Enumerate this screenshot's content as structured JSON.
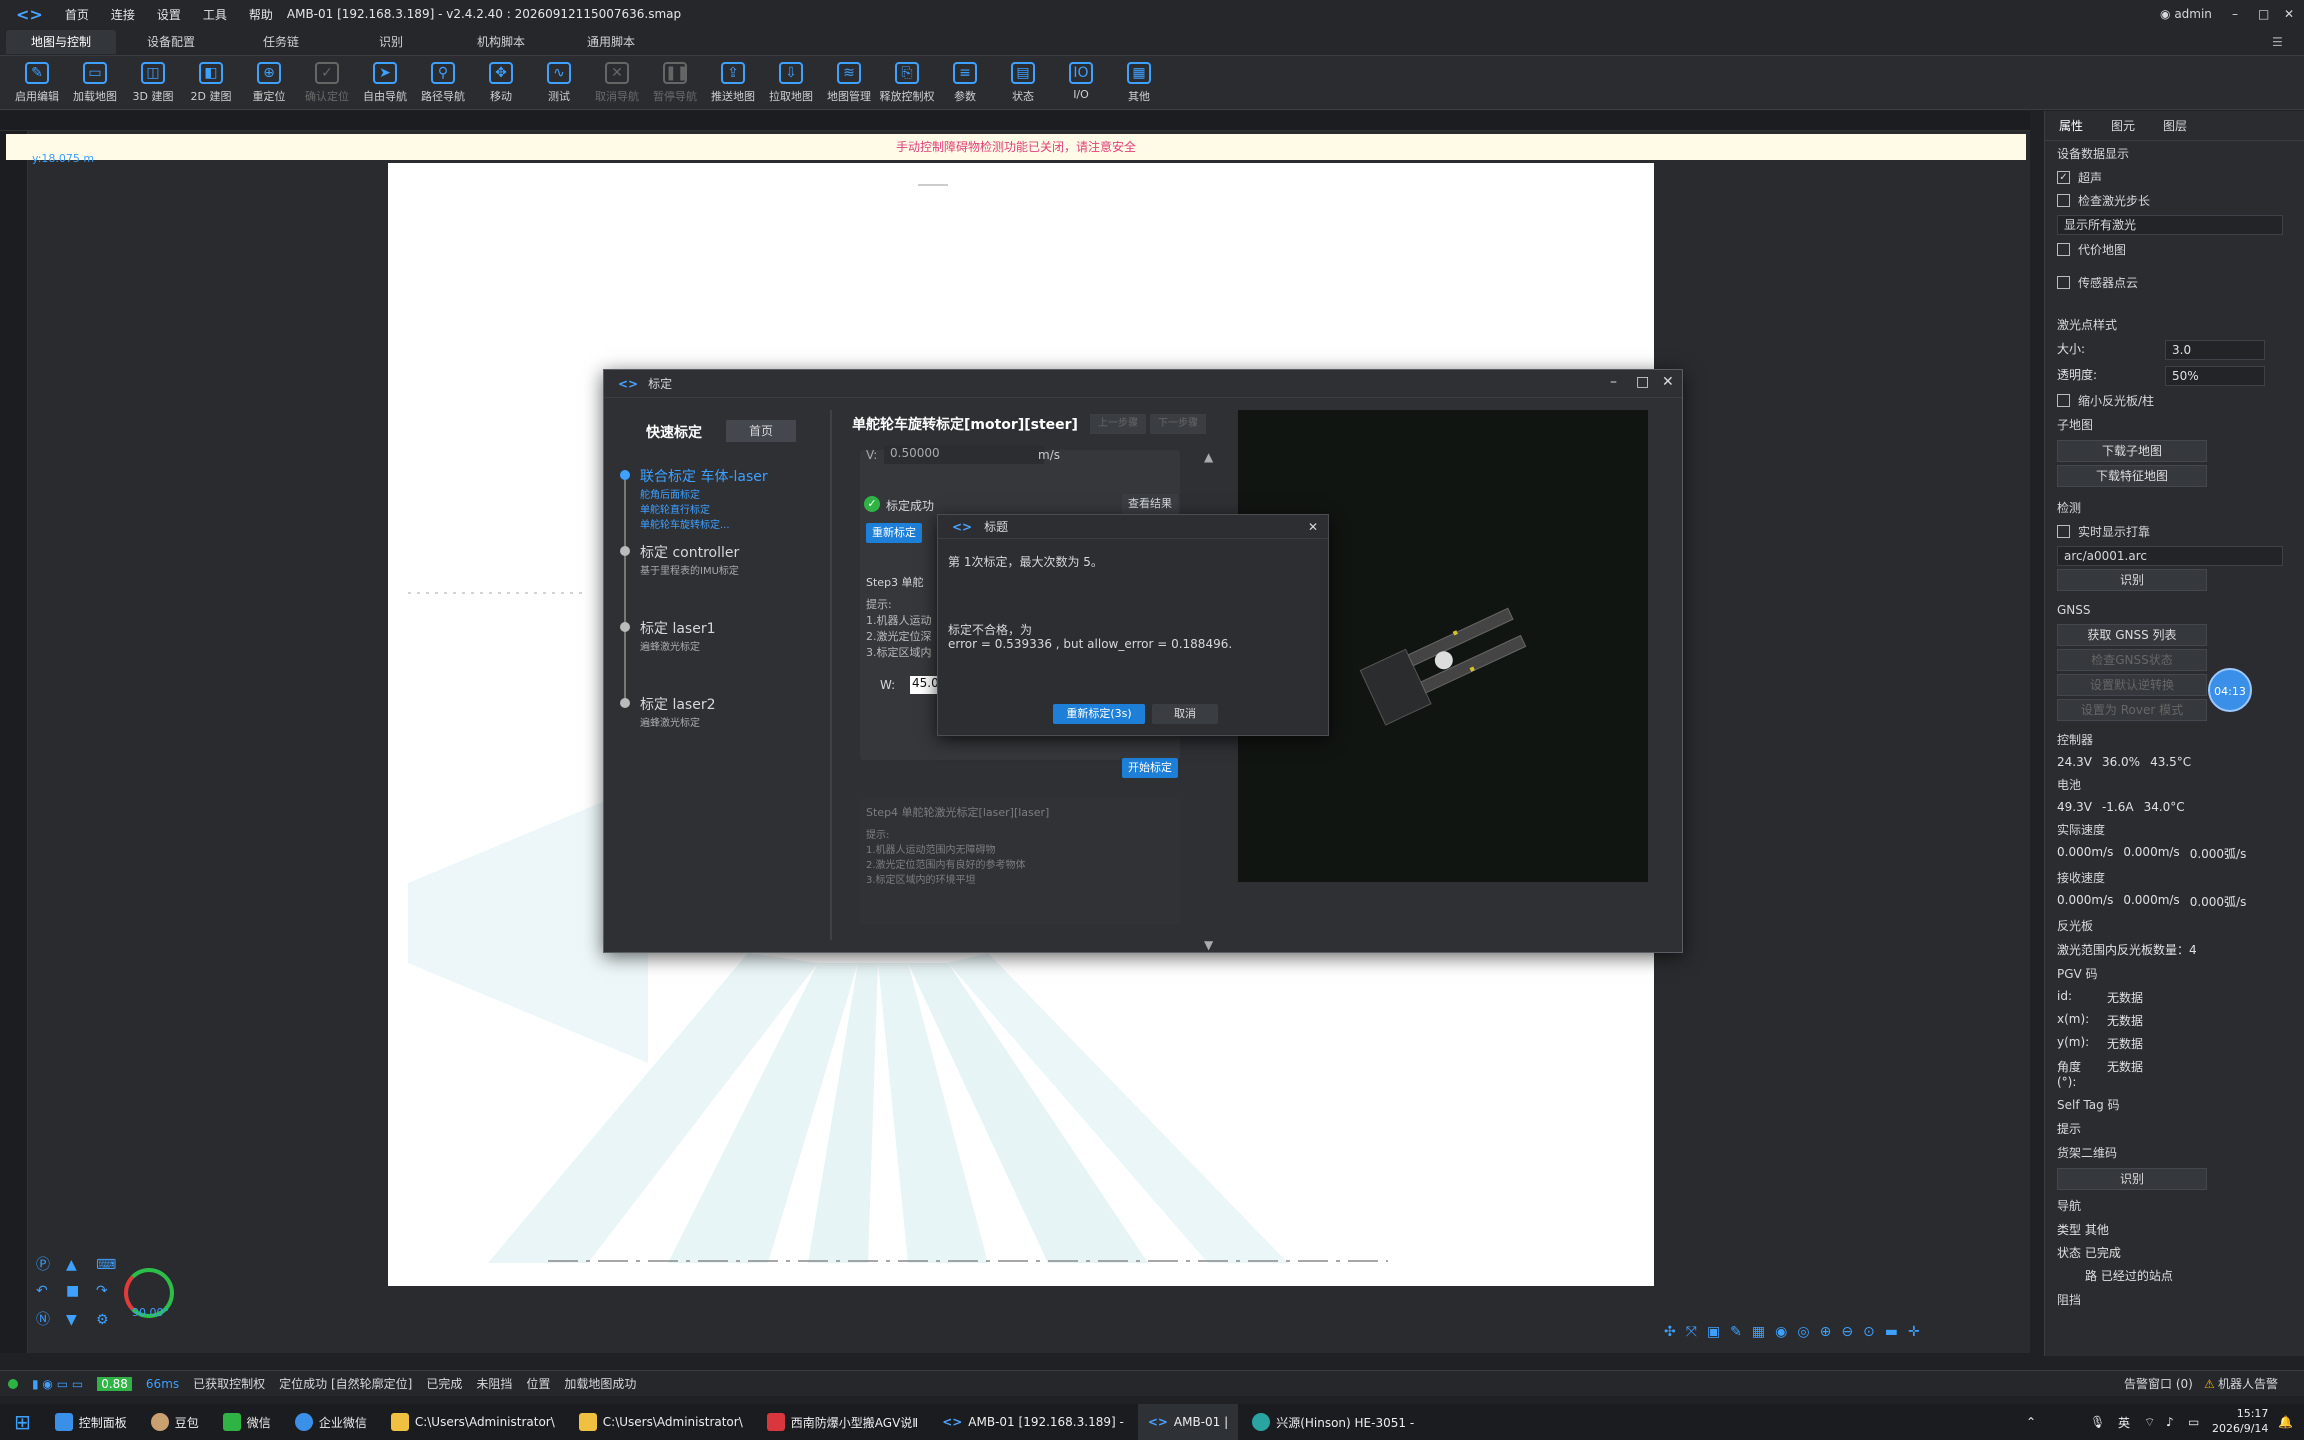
{
  "titlebar": {
    "menus": [
      "首页",
      "连接",
      "设置",
      "工具",
      "帮助"
    ],
    "title": "AMB-01 [192.168.3.189] - v2.4.2.40 : 20260912115007636.smap",
    "user": "admin"
  },
  "tabs": [
    "地图与控制",
    "设备配置",
    "任务链",
    "识别",
    "机构脚本",
    "通用脚本"
  ],
  "toolbar": [
    {
      "label": "启用编辑",
      "icon": "edit-icon",
      "dim": false
    },
    {
      "label": "加载地图",
      "icon": "folder-icon",
      "dim": false
    },
    {
      "label": "3D 建图",
      "icon": "map3d-icon",
      "dim": false
    },
    {
      "label": "2D 建图",
      "icon": "map2d-icon",
      "dim": false
    },
    {
      "label": "重定位",
      "icon": "target-icon",
      "dim": false
    },
    {
      "label": "确认定位",
      "icon": "check-icon",
      "dim": true
    },
    {
      "label": "自由导航",
      "icon": "nav-icon",
      "dim": false
    },
    {
      "label": "路径导航",
      "icon": "pin-icon",
      "dim": false
    },
    {
      "label": "移动",
      "icon": "move-icon",
      "dim": false
    },
    {
      "label": "测试",
      "icon": "test-icon",
      "dim": false
    },
    {
      "label": "取消导航",
      "icon": "cancel-icon",
      "dim": true
    },
    {
      "label": "暂停导航",
      "icon": "pause-icon",
      "dim": true
    },
    {
      "label": "推送地图",
      "icon": "upload-icon",
      "dim": false
    },
    {
      "label": "拉取地图",
      "icon": "download-icon",
      "dim": false
    },
    {
      "label": "地图管理",
      "icon": "layers-icon",
      "dim": false
    },
    {
      "label": "释放控制权",
      "icon": "release-icon",
      "dim": false
    },
    {
      "label": "参数",
      "icon": "params-icon",
      "dim": false
    },
    {
      "label": "状态",
      "icon": "status-icon",
      "dim": false
    },
    {
      "label": "I/O",
      "icon": "io-icon",
      "dim": false
    },
    {
      "label": "其他",
      "icon": "grid-icon",
      "dim": false
    }
  ],
  "canvas": {
    "warning": "手动控制障碍物检测功能已关闭，请注意安全",
    "coord_y": "y:18.075 m",
    "heading": "90.00°"
  },
  "calibration": {
    "title": "标定",
    "quick_label": "快速标定",
    "home_btn": "首页",
    "steps": [
      {
        "title": "联合标定 车体-laser",
        "subs": [
          "舵角后面标定",
          "单舵轮直行标定",
          "单舵轮车旋转标定..."
        ],
        "active": true
      },
      {
        "title": "标定 controller",
        "subs": [
          "基于里程表的IMU标定"
        ],
        "active": false
      },
      {
        "title": "标定 laser1",
        "subs": [
          "遍蜂激光标定"
        ],
        "active": false
      },
      {
        "title": "标定 laser2",
        "subs": [
          "遍蜂激光标定"
        ],
        "active": false
      }
    ],
    "panel_title": "单舵轮车旋转标定[motor][steer]",
    "prev_btn": "上一步骤",
    "next_btn": "下一步骤",
    "v_label": "V:",
    "v_value": "0.50000",
    "v_unit": "m/s",
    "success_text": "标定成功",
    "view_result": "查看结果",
    "recalib_btn": "重新标定",
    "step3_title": "Step3  单舵",
    "hint_label": "提示:",
    "hints": [
      "1.机器人运动",
      "2.激光定位深",
      "3.标定区域内"
    ],
    "w_label": "W:",
    "w_value": "45.0",
    "start_btn": "开始标定",
    "step4_title": "Step4  单舵轮激光标定[laser][laser]",
    "step4_hint": "提示:",
    "step4_hints": [
      "1.机器人运动范围内无障碍物",
      "2.激光定位范围内有良好的参考物体",
      "3.标定区域内的环境平坦"
    ]
  },
  "dialog": {
    "title": "标题",
    "line1": "第 1次标定，最大次数为 5。",
    "line2": "标定不合格，为",
    "line3": "error = 0.539336 , but allow_error = 0.188496.",
    "retry_btn": "重新标定(3s)",
    "cancel_btn": "取消"
  },
  "right_panel": {
    "tabs": [
      "属性",
      "图元",
      "图层"
    ],
    "device_display": "设备数据显示",
    "checks": [
      {
        "label": "超声",
        "checked": true
      },
      {
        "label": "检查激光步长",
        "checked": false
      }
    ],
    "show_all_laser": "显示所有激光",
    "cost_map": "代价地图",
    "sensor_cloud": "传感器点云",
    "laser_style": "激光点样式",
    "size_label": "大小:",
    "size_value": "3.0",
    "opacity_label": "透明度:",
    "opacity_value": "50%",
    "small_reflector": "缩小反光板/柱",
    "submap": "子地图",
    "download_submap": "下载子地图",
    "download_feature": "下载特征地图",
    "detect": "检测",
    "realtime_show": "实时显示打靠",
    "arc_file": "arc/a0001.arc",
    "identify_btn": "识别",
    "gnss": "GNSS",
    "gnss_list": "获取 GNSS 列表",
    "check_gnss": "检查GNSS状态",
    "set_default": "设置默认逆转换",
    "set_rover": "设置为 Rover 模式",
    "controller": "控制器",
    "controller_vals": [
      "24.3V",
      "36.0%",
      "43.5°C"
    ],
    "battery": "电池",
    "battery_vals": [
      "49.3V",
      "-1.6A",
      "34.0°C"
    ],
    "actual_speed": "实际速度",
    "actual_vals": [
      "0.000m/s",
      "0.000m/s",
      "0.000弧/s"
    ],
    "recv_speed": "接收速度",
    "recv_vals": [
      "0.000m/s",
      "0.000m/s",
      "0.000弧/s"
    ],
    "reflector": "反光板",
    "reflector_count": "激光范围内反光板数量：4",
    "pgv": "PGV 码",
    "pgv_rows": [
      {
        "k": "id:",
        "v": "无数据"
      },
      {
        "k": "x(m):",
        "v": "无数据"
      },
      {
        "k": "y(m):",
        "v": "无数据"
      },
      {
        "k": "角度(°):",
        "v": "无数据"
      }
    ],
    "self_tag": "Self Tag 码",
    "hint": "提示",
    "qr2": "货架二维码",
    "identify2": "识别",
    "nav": "导航",
    "nav_type": "类型  其他",
    "nav_state": "状态  已完成",
    "passed_sites": "路  已经过的站点",
    "block": "阻挡",
    "time_badge": "04:13"
  },
  "statusbar": {
    "battery_val": "0.88",
    "latency": "66ms",
    "items": [
      "已获取控制权",
      "定位成功 [自然轮廓定位]",
      "已完成",
      "未阻挡",
      "位置",
      "加载地图成功"
    ],
    "alarm_window": "告警窗口 (0)",
    "robot_alarm": "机器人告警"
  },
  "taskbar": {
    "items": [
      "控制面板",
      "豆包",
      "微信",
      "企业微信",
      "C:\\Users\\Administrator\\",
      "C:\\Users\\Administrator\\",
      "西南防爆小型搬AGV说Ⅱ",
      "AMB-01 [192.168.3.189] -",
      "AMB-01 |",
      "兴源(Hinson) HE-3051 -"
    ],
    "ime": "英",
    "time": "15:17",
    "date": "2026/9/14"
  },
  "colors": {
    "accent": "#3ea0ff",
    "warning_text": "#e0407a",
    "success": "#2fb344"
  }
}
